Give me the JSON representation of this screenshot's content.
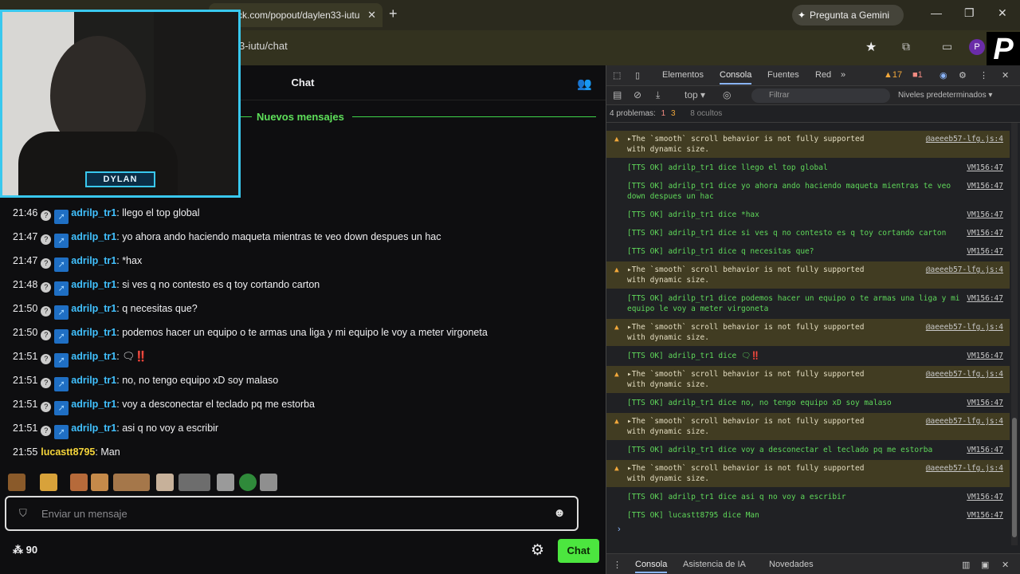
{
  "browser": {
    "tab_title": "ck.com/popout/daylen33-iutu",
    "url": "3-iutu/chat",
    "gemini_label": "Pregunta a Gemini",
    "profile_initial": "P",
    "logo_letter": "P"
  },
  "chat": {
    "title": "Chat",
    "new_messages": "Nuevos mensajes",
    "streamer_tag": "DYLAN",
    "messages": [
      {
        "time": "21:46",
        "user": "adrilp_tr1",
        "text": ": llego el top global"
      },
      {
        "time": "21:47",
        "user": "adrilp_tr1",
        "text": ": yo ahora ando haciendo maqueta mientras te veo down despues un hac"
      },
      {
        "time": "21:47",
        "user": "adrilp_tr1",
        "text": ": *hax"
      },
      {
        "time": "21:48",
        "user": "adrilp_tr1",
        "text": ": si ves q no contesto es q toy cortando carton"
      },
      {
        "time": "21:50",
        "user": "adrilp_tr1",
        "text": ": q necesitas que?"
      },
      {
        "time": "21:50",
        "user": "adrilp_tr1",
        "text": ": podemos hacer un equipo o te armas una liga y mi equipo le voy a meter virgoneta"
      },
      {
        "time": "21:51",
        "user": "adrilp_tr1",
        "text": ": 🗨‼️"
      },
      {
        "time": "21:51",
        "user": "adrilp_tr1",
        "text": ": no, no tengo equipo xD soy malaso"
      },
      {
        "time": "21:51",
        "user": "adrilp_tr1",
        "text": ": voy a desconectar el teclado pq me estorba"
      },
      {
        "time": "21:51",
        "user": "adrilp_tr1",
        "text": ": asi q no voy a escribir"
      },
      {
        "time": "21:55",
        "user": "lucastt8795",
        "text": ": Man"
      }
    ],
    "input_placeholder": "Enviar un mensaje",
    "points": "90",
    "chat_button": "Chat"
  },
  "devtools": {
    "tabs": [
      "Elementos",
      "Consola",
      "Fuentes",
      "Red"
    ],
    "warnings_count": "17",
    "errors_count": "1",
    "context": "top",
    "filter_placeholder": "Filtrar",
    "levels": "Niveles predeterminados",
    "issues": "4 problemas:",
    "issues_a": "1",
    "issues_b": "3",
    "hidden": "8 ocultos",
    "bottom_tabs": [
      "Consola",
      "Asistencia de IA",
      "Novedades"
    ],
    "logs": [
      {
        "kind": "warn",
        "text": "▸The `smooth` scroll behavior is not fully supported\nwith dynamic size.",
        "src": "@aeeeb57-lfg.js:4"
      },
      {
        "kind": "ok",
        "text": "[TTS OK] adrilp_tr1 dice llego el top global",
        "src": "VM156:47"
      },
      {
        "kind": "ok",
        "text": "[TTS OK] adrilp_tr1 dice yo ahora ando haciendo maqueta mientras te veo\ndown despues un hac",
        "src": "VM156:47"
      },
      {
        "kind": "ok",
        "text": "[TTS OK] adrilp_tr1 dice *hax",
        "src": "VM156:47"
      },
      {
        "kind": "ok",
        "text": "[TTS OK] adrilp_tr1 dice si ves q no contesto es q toy cortando carton",
        "src": "VM156:47"
      },
      {
        "kind": "ok",
        "text": "[TTS OK] adrilp_tr1 dice q necesitas que?",
        "src": "VM156:47"
      },
      {
        "kind": "warn",
        "text": "▸The `smooth` scroll behavior is not fully supported\nwith dynamic size.",
        "src": "@aeeeb57-lfg.js:4"
      },
      {
        "kind": "ok",
        "text": "[TTS OK] adrilp_tr1 dice podemos hacer un equipo o te armas una liga y mi\nequipo le voy a meter virgoneta",
        "src": "VM156:47"
      },
      {
        "kind": "warn",
        "text": "▸The `smooth` scroll behavior is not fully supported\nwith dynamic size.",
        "src": "@aeeeb57-lfg.js:4"
      },
      {
        "kind": "ok",
        "text": "[TTS OK] adrilp_tr1 dice 🗨‼️",
        "src": "VM156:47"
      },
      {
        "kind": "warn",
        "text": "▸The `smooth` scroll behavior is not fully supported\nwith dynamic size.",
        "src": "@aeeeb57-lfg.js:4"
      },
      {
        "kind": "ok",
        "text": "[TTS OK] adrilp_tr1 dice no, no tengo equipo xD soy malaso",
        "src": "VM156:47"
      },
      {
        "kind": "warn",
        "text": "▸The `smooth` scroll behavior is not fully supported\nwith dynamic size.",
        "src": "@aeeeb57-lfg.js:4"
      },
      {
        "kind": "ok",
        "text": "[TTS OK] adrilp_tr1 dice voy a desconectar el teclado pq me estorba",
        "src": "VM156:47"
      },
      {
        "kind": "warn",
        "text": "▸The `smooth` scroll behavior is not fully supported\nwith dynamic size.",
        "src": "@aeeeb57-lfg.js:4"
      },
      {
        "kind": "ok",
        "text": "[TTS OK] adrilp_tr1 dice asi q no voy a escribir",
        "src": "VM156:47"
      },
      {
        "kind": "ok",
        "text": "[TTS OK] lucastt8795 dice Man",
        "src": "VM156:47"
      }
    ]
  },
  "colors": {
    "accent_green": "#4ce63f",
    "username_blue": "#41c1ff",
    "username_yellow": "#f5d53a",
    "cam_border": "#39c8ee"
  }
}
